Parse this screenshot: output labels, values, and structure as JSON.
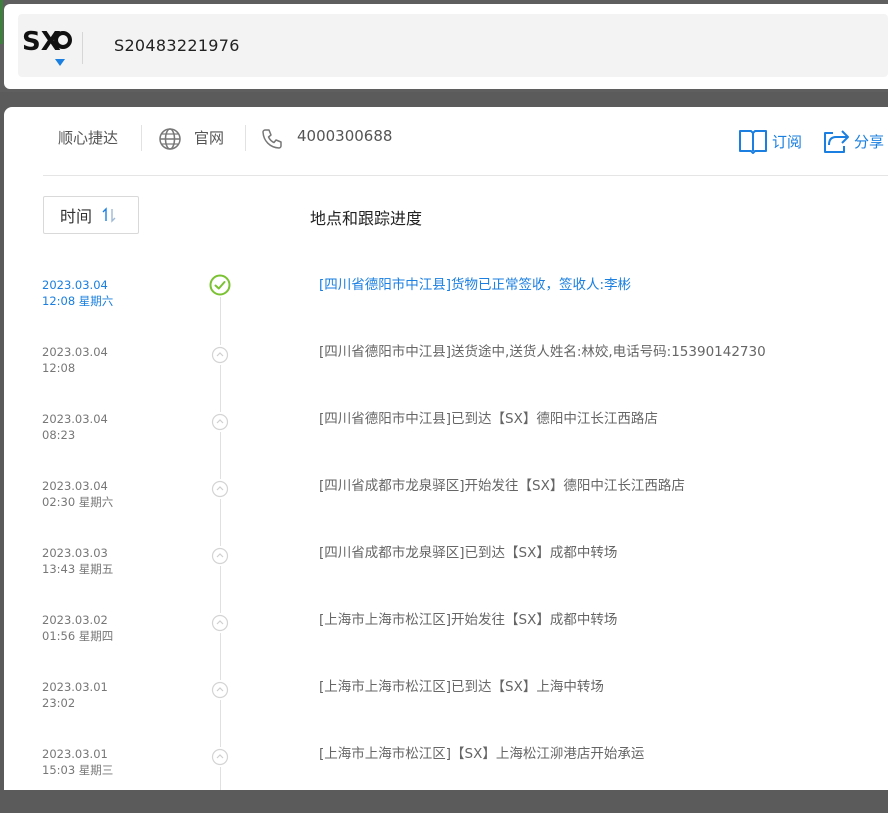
{
  "search": {
    "tracking_number": "S20483221976",
    "logo_text": "SX",
    "logo_icon": "sx-logo-icon"
  },
  "carrier_bar": {
    "carrier_name": "顺心捷达",
    "website_label": "官网",
    "phone": "4000300688",
    "subscribe_label": "订阅",
    "share_label": "分享"
  },
  "colors": {
    "accent": "#1a7fe0",
    "success": "#7ac231",
    "text_muted": "#666666"
  },
  "timeline": {
    "sort_label": "时间",
    "column_title": "地点和跟踪进度",
    "events": [
      {
        "date": "2023.03.04",
        "time": "12:08 星期六",
        "desc": "[四川省德阳市中江县]货物已正常签收，签收人:李彬",
        "status": "delivered"
      },
      {
        "date": "2023.03.04",
        "time": "12:08",
        "desc": "[四川省德阳市中江县]送货途中,送货人姓名:林姣,电话号码:15390142730",
        "status": "transit"
      },
      {
        "date": "2023.03.04",
        "time": "08:23",
        "desc": "[四川省德阳市中江县]已到达【SX】德阳中江长江西路店",
        "status": "transit"
      },
      {
        "date": "2023.03.04",
        "time": "02:30 星期六",
        "desc": "[四川省成都市龙泉驿区]开始发往【SX】德阳中江长江西路店",
        "status": "transit"
      },
      {
        "date": "2023.03.03",
        "time": "13:43 星期五",
        "desc": "[四川省成都市龙泉驿区]已到达【SX】成都中转场",
        "status": "transit"
      },
      {
        "date": "2023.03.02",
        "time": "01:56 星期四",
        "desc": "[上海市上海市松江区]开始发往【SX】成都中转场",
        "status": "transit"
      },
      {
        "date": "2023.03.01",
        "time": "23:02",
        "desc": "[上海市上海市松江区]已到达【SX】上海中转场",
        "status": "transit"
      },
      {
        "date": "2023.03.01",
        "time": "15:03 星期三",
        "desc": "[上海市上海市松江区]【SX】上海松江泖港店开始承运",
        "status": "transit"
      }
    ]
  }
}
